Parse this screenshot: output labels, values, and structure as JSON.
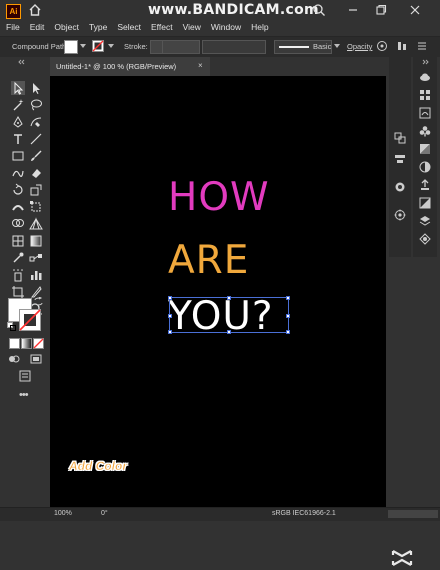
{
  "watermark": "www.BANDICAM.com",
  "app": {
    "logo_text": "Ai"
  },
  "menu": [
    "File",
    "Edit",
    "Object",
    "Type",
    "Select",
    "Effect",
    "View",
    "Window",
    "Help"
  ],
  "control_bar": {
    "selection_type": "Compound Path",
    "stroke_label": "Stroke:",
    "brush_preset": "Basic",
    "opacity_label": "Opacity",
    "fill_color": "#ffffff",
    "stroke_color": "#ff4040"
  },
  "document_tab": {
    "title": "Untitled-1* @ 100 % (RGB/Preview)",
    "close": "×"
  },
  "artwork": {
    "line1": "HOW",
    "line2": "ARE",
    "line3": "YOU?",
    "line1_color": "#e23bbf",
    "line2_color": "#f0a83c",
    "line3_color": "#ffffff",
    "overlay_caption": "Add Color"
  },
  "status_bar": {
    "zoom": "100%",
    "rotation": "0°",
    "color_profile": "sRGB IEC61966-2.1"
  }
}
